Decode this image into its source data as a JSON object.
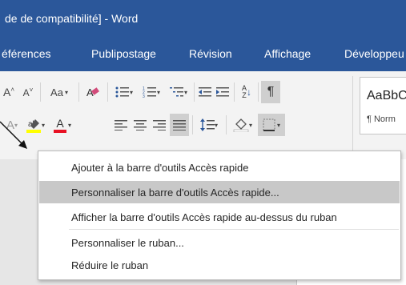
{
  "title_bar": {
    "text": "de de compatibilité] - Word"
  },
  "tabs": [
    "éférences",
    "Publipostage",
    "Révision",
    "Affichage",
    "Développeu"
  ],
  "ribbon": {
    "font_grow": "A",
    "font_shrink": "A",
    "change_case": "Aa",
    "font_color_letter": "A",
    "sort_icon": "↓",
    "pilcrow": "¶",
    "style_sample": "AaBbC",
    "style_name": "¶ Norm"
  },
  "context_menu": {
    "items": [
      "Ajouter à la barre d'outils Accès rapide",
      "Personnaliser la barre d'outils Accès rapide...",
      "Afficher la barre d'outils Accès rapide au-dessus du ruban",
      "Personnaliser le ruban...",
      "Réduire le ruban"
    ],
    "highlight_color": "#c8c8c8"
  },
  "colors": {
    "accent": "#2b579a",
    "ribbon_bg": "#f3f3f3",
    "highlight_yellow": "#ffff00",
    "font_red": "#e81123"
  }
}
